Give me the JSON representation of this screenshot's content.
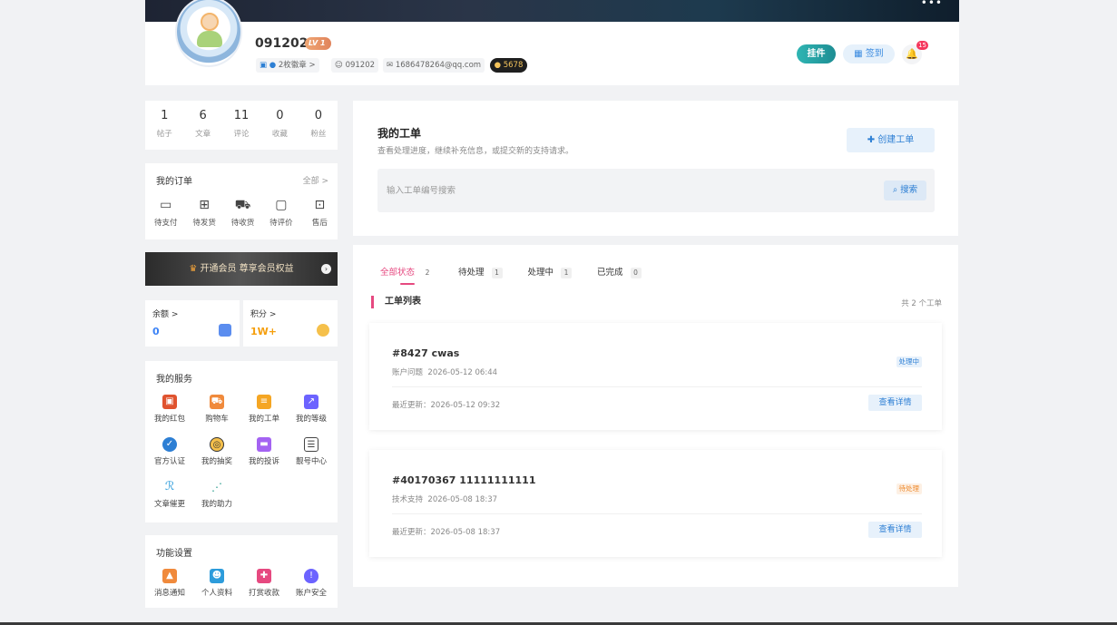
{
  "header": {
    "more_label": "•••",
    "username": "091202",
    "level": "LV 1",
    "badges_label": "2枚徽章 >",
    "user_id": "091202",
    "email": "1686478264@qq.com",
    "points": "5678",
    "pendant_label": "挂件",
    "sign_label": "签到",
    "notification_count": "15"
  },
  "stats": [
    {
      "value": "1",
      "label": "帖子"
    },
    {
      "value": "6",
      "label": "文章"
    },
    {
      "value": "11",
      "label": "评论"
    },
    {
      "value": "0",
      "label": "收藏"
    },
    {
      "value": "0",
      "label": "粉丝"
    }
  ],
  "orders": {
    "title": "我的订单",
    "more": "全部 >",
    "items": [
      {
        "label": "待支付",
        "icon": "wallet-icon"
      },
      {
        "label": "待发货",
        "icon": "package-icon"
      },
      {
        "label": "待收货",
        "icon": "truck-icon"
      },
      {
        "label": "待评价",
        "icon": "comment-icon"
      },
      {
        "label": "售后",
        "icon": "refund-icon"
      }
    ]
  },
  "vip": {
    "label": "开通会员 尊享会员权益"
  },
  "balance": {
    "title": "余额 >",
    "value": "0",
    "color": "#3b82f6"
  },
  "score": {
    "title": "积分 >",
    "value": "1W+",
    "color": "#f59e0b"
  },
  "services": {
    "title": "我的服务",
    "items": [
      {
        "label": "我的红包",
        "icon": "red-envelope-icon",
        "color": "#e0532f"
      },
      {
        "label": "购物车",
        "icon": "cart-icon",
        "color": "#f08a3c"
      },
      {
        "label": "我的工单",
        "icon": "ticket-icon",
        "color": "#f5a623"
      },
      {
        "label": "我的等级",
        "icon": "chart-icon",
        "color": "#6c63ff"
      },
      {
        "label": "官方认证",
        "icon": "verified-icon",
        "color": "#2d7fd4"
      },
      {
        "label": "我的抽奖",
        "icon": "lottery-icon",
        "color": "#333333"
      },
      {
        "label": "我的投诉",
        "icon": "complaint-icon",
        "color": "#a463f2"
      },
      {
        "label": "靓号中心",
        "icon": "id-card-icon",
        "color": "#444444"
      },
      {
        "label": "文章催更",
        "icon": "urge-icon",
        "color": "#2d9cdb"
      },
      {
        "label": "我的助力",
        "icon": "share-icon",
        "color": "#2a9d8f"
      }
    ]
  },
  "settings": {
    "title": "功能设置",
    "items": [
      {
        "label": "消息通知",
        "icon": "bell-icon",
        "color": "#f08a3c"
      },
      {
        "label": "个人资料",
        "icon": "profile-icon",
        "color": "#2d9cdb"
      },
      {
        "label": "打赏收款",
        "icon": "gift-icon",
        "color": "#e64980"
      },
      {
        "label": "账户安全",
        "icon": "shield-icon",
        "color": "#6c63ff"
      }
    ]
  },
  "workorder": {
    "title": "我的工单",
    "subtitle": "查看处理进度，继续补充信息，或提交新的支持请求。",
    "create_label": "创建工单",
    "search_placeholder": "输入工单编号搜索",
    "search_label": "搜索"
  },
  "tabs": [
    {
      "label": "全部状态",
      "count": "2"
    },
    {
      "label": "待处理",
      "count": "1"
    },
    {
      "label": "处理中",
      "count": "1"
    },
    {
      "label": "已完成",
      "count": "0"
    }
  ],
  "list": {
    "title": "工单列表",
    "total": "共 2 个工单",
    "tickets": [
      {
        "id": "#8427 cwas",
        "category": "账户问题",
        "created": "2026-05-12 06:44",
        "status": "处理中",
        "updated": "最近更新：2026-05-12 09:32",
        "detail_label": "查看详情"
      },
      {
        "id": "#40170367 11111111111",
        "category": "技术支持",
        "created": "2026-05-08 18:37",
        "status": "待处理",
        "updated": "最近更新：2026-05-08 18:37",
        "detail_label": "查看详情"
      }
    ]
  }
}
